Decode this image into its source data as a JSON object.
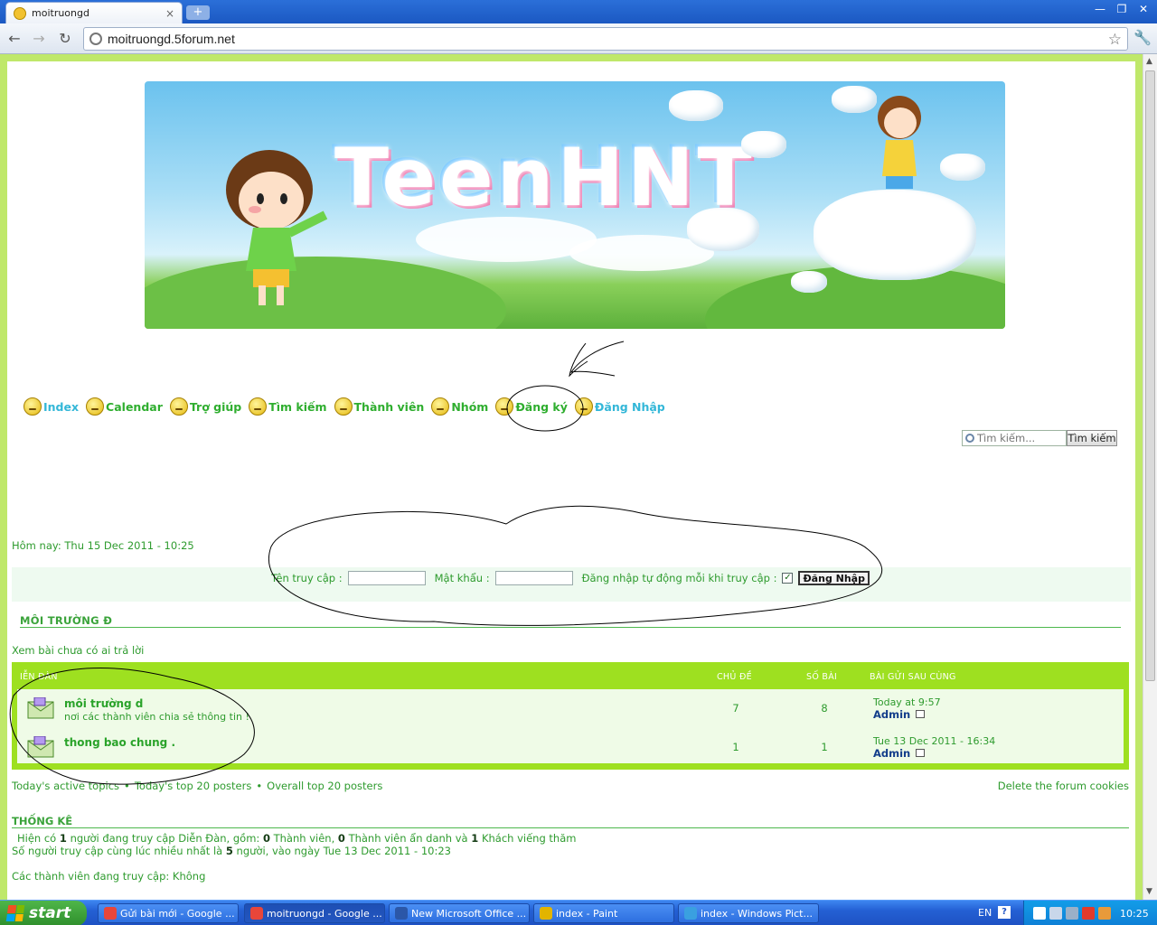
{
  "browser": {
    "tab_title": "moitruongd",
    "tab_close": "×",
    "new_tab": "+",
    "url": "moitruongd.5forum.net",
    "win_min": "—",
    "win_max": "❐",
    "win_close": "✕"
  },
  "nav": {
    "back": "←",
    "forward": "→",
    "reload": "↻",
    "star": "☆",
    "wrench": "🔧"
  },
  "banner": {
    "logo_text": "TeenHNT"
  },
  "menu": [
    {
      "label": "Index"
    },
    {
      "label": "Calendar"
    },
    {
      "label": "Trợ giúp"
    },
    {
      "label": "Tìm kiếm"
    },
    {
      "label": "Thành viên"
    },
    {
      "label": "Nhóm"
    },
    {
      "label": "Đăng ký"
    },
    {
      "label": "Đăng Nhập"
    }
  ],
  "search": {
    "placeholder": "Tìm kiếm...",
    "button": "Tìm kiếm"
  },
  "today": "Hôm nay: Thu 15 Dec 2011 - 10:25",
  "login": {
    "username_label": "Tên truy cập :",
    "password_label": "Mật khẩu :",
    "auto_label": "Đăng nhập tự động mỗi khi truy cập :",
    "auto_checked": "✓",
    "button": "Đăng Nhập"
  },
  "category": "MÔI TRƯỜNG Đ",
  "unanswered": "Xem bài chưa có ai trả lời",
  "table": {
    "headers": [
      "IỄN ĐÀN",
      "CHỦ ĐỀ",
      "SỐ BÀI",
      "BÀI GỬI SAU CÙNG"
    ],
    "rows": [
      {
        "title": "môi trường d",
        "desc": "nơi các thành viên chia sẻ thông tin !",
        "topics": "7",
        "posts": "8",
        "last_date": "Today at 9:57",
        "last_author": "Admin"
      },
      {
        "title": "thong bao chung .",
        "desc": "",
        "topics": "1",
        "posts": "1",
        "last_date": "Tue 13 Dec 2011 - 16:34",
        "last_author": "Admin"
      }
    ]
  },
  "footer": {
    "active_topics": "Today's active topics",
    "sep": "•",
    "top_today": "Today's top 20 posters",
    "top_overall": "Overall top 20 posters",
    "delete_cookies": "Delete the forum cookies"
  },
  "stats": {
    "title": "THỐNG KÊ",
    "line1_a": "Hiện có",
    "line1_b": "1",
    "line1_c": "người đang truy cập Diễn Đàn, gồm:",
    "line1_d": "0",
    "line1_e": "Thành viên,",
    "line1_f": "0",
    "line1_g": "Thành viên ẩn danh và",
    "line1_h": "1",
    "line1_i": "Khách viếng thăm",
    "line2_a": "Số người truy cập cùng lúc nhiều nhất là",
    "line2_b": "5",
    "line2_c": "người, vào ngày Tue 13 Dec 2011 - 10:23",
    "line3": "Các thành viên đang truy cập: Không"
  },
  "taskbar": {
    "start": "start",
    "tasks": [
      {
        "label": "Gửi bài mới - Google ..."
      },
      {
        "label": "moitruongd - Google ..."
      },
      {
        "label": "New Microsoft Office ..."
      },
      {
        "label": "index - Paint"
      },
      {
        "label": "index - Windows Pict..."
      }
    ],
    "lang": "EN",
    "help": "?",
    "clock": "10:25"
  }
}
